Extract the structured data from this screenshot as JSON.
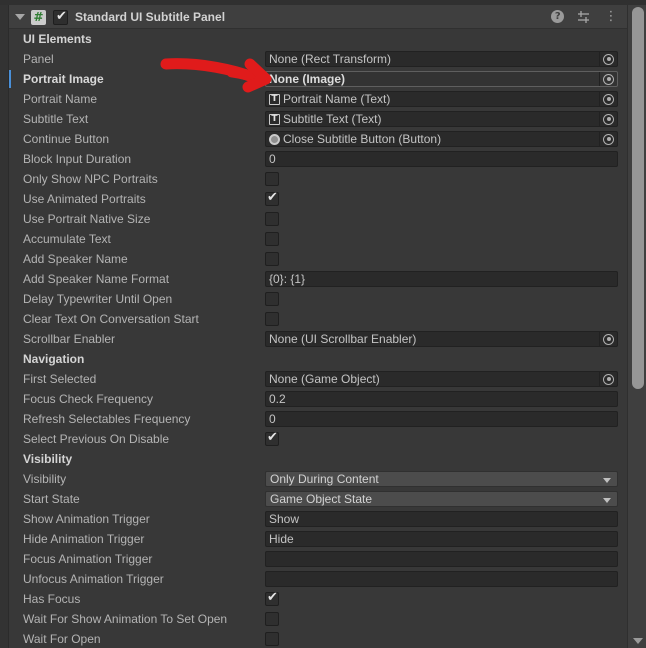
{
  "window": {
    "component_title": "Standard UI Subtitle Panel",
    "script_icon_glyph": "#",
    "enabled": true,
    "header_icons": [
      {
        "name": "help-icon",
        "glyph": "?"
      },
      {
        "name": "preset-icon",
        "glyph": ""
      },
      {
        "name": "menu-icon",
        "glyph": "⋮"
      }
    ]
  },
  "accent_colors": {
    "modified_marker": "#4a90d9",
    "annotation_arrow": "#e01b1b",
    "script_icon_text": "#2f7d32",
    "panel_background": "#383838",
    "header_background": "#3f3f3f",
    "field_background": "#2a2a2a",
    "dropdown_background": "#4c4c4c"
  },
  "annotation": {
    "type": "arrow",
    "color": "#e01b1b",
    "points_to": "Portrait Image"
  },
  "rows": [
    {
      "label": "UI Elements",
      "type": "section"
    },
    {
      "label": "Panel",
      "type": "object",
      "value": "None (Rect Transform)",
      "icon": "none"
    },
    {
      "label": "Portrait Image",
      "type": "object",
      "value": "None (Image)",
      "icon": "none",
      "modified": true
    },
    {
      "label": "Portrait Name",
      "type": "object",
      "value": "Portrait Name (Text)",
      "icon": "text"
    },
    {
      "label": "Subtitle Text",
      "type": "object",
      "value": "Subtitle Text (Text)",
      "icon": "text"
    },
    {
      "label": "Continue Button",
      "type": "object",
      "value": "Close Subtitle Button (Button)",
      "icon": "button"
    },
    {
      "label": "Block Input Duration",
      "type": "number",
      "value": "0"
    },
    {
      "label": "Only Show NPC Portraits",
      "type": "checkbox",
      "checked": false
    },
    {
      "label": "Use Animated Portraits",
      "type": "checkbox",
      "checked": true
    },
    {
      "label": "Use Portrait Native Size",
      "type": "checkbox",
      "checked": false
    },
    {
      "label": "Accumulate Text",
      "type": "checkbox",
      "checked": false
    },
    {
      "label": "Add Speaker Name",
      "type": "checkbox",
      "checked": false
    },
    {
      "label": "Add Speaker Name Format",
      "type": "text",
      "value": "{0}: {1}"
    },
    {
      "label": "Delay Typewriter Until Open",
      "type": "checkbox",
      "checked": false
    },
    {
      "label": "Clear Text On Conversation Start",
      "type": "checkbox",
      "checked": false
    },
    {
      "label": "Scrollbar Enabler",
      "type": "object",
      "value": "None (UI Scrollbar Enabler)",
      "icon": "none"
    },
    {
      "label": "Navigation",
      "type": "section"
    },
    {
      "label": "First Selected",
      "type": "object",
      "value": "None (Game Object)",
      "icon": "none"
    },
    {
      "label": "Focus Check Frequency",
      "type": "number",
      "value": "0.2"
    },
    {
      "label": "Refresh Selectables Frequency",
      "type": "number",
      "value": "0"
    },
    {
      "label": "Select Previous On Disable",
      "type": "checkbox",
      "checked": true
    },
    {
      "label": "Visibility",
      "type": "section"
    },
    {
      "label": "Visibility",
      "type": "dropdown",
      "value": "Only During Content"
    },
    {
      "label": "Start State",
      "type": "dropdown",
      "value": "Game Object State"
    },
    {
      "label": "Show Animation Trigger",
      "type": "text",
      "value": "Show"
    },
    {
      "label": "Hide Animation Trigger",
      "type": "text",
      "value": "Hide"
    },
    {
      "label": "Focus Animation Trigger",
      "type": "text",
      "value": ""
    },
    {
      "label": "Unfocus Animation Trigger",
      "type": "text",
      "value": ""
    },
    {
      "label": "Has Focus",
      "type": "checkbox",
      "checked": true
    },
    {
      "label": "Wait For Show Animation To Set Open",
      "type": "checkbox",
      "checked": false
    },
    {
      "label": "Wait For Open",
      "type": "checkbox",
      "checked": false
    }
  ]
}
